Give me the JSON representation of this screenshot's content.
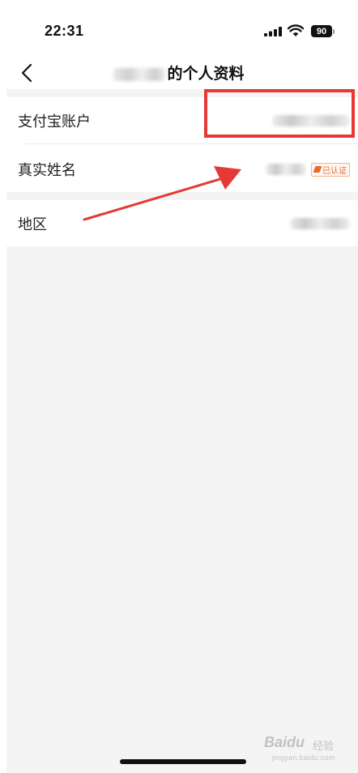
{
  "status_bar": {
    "time": "22:31",
    "battery": "90"
  },
  "nav": {
    "title": "的个人资料"
  },
  "rows": [
    {
      "label": "支付宝账户",
      "value_note": "blurred"
    },
    {
      "label": "真实姓名",
      "badge": "已认证"
    },
    {
      "label": "地区",
      "value_note": "blurred"
    }
  ],
  "annotations": {
    "highlight_color": "#e53935",
    "arrow_color": "#e53935"
  },
  "watermark": {
    "brand": "Baidu",
    "sub": "经验",
    "url": "jingyan.baidu.com"
  }
}
